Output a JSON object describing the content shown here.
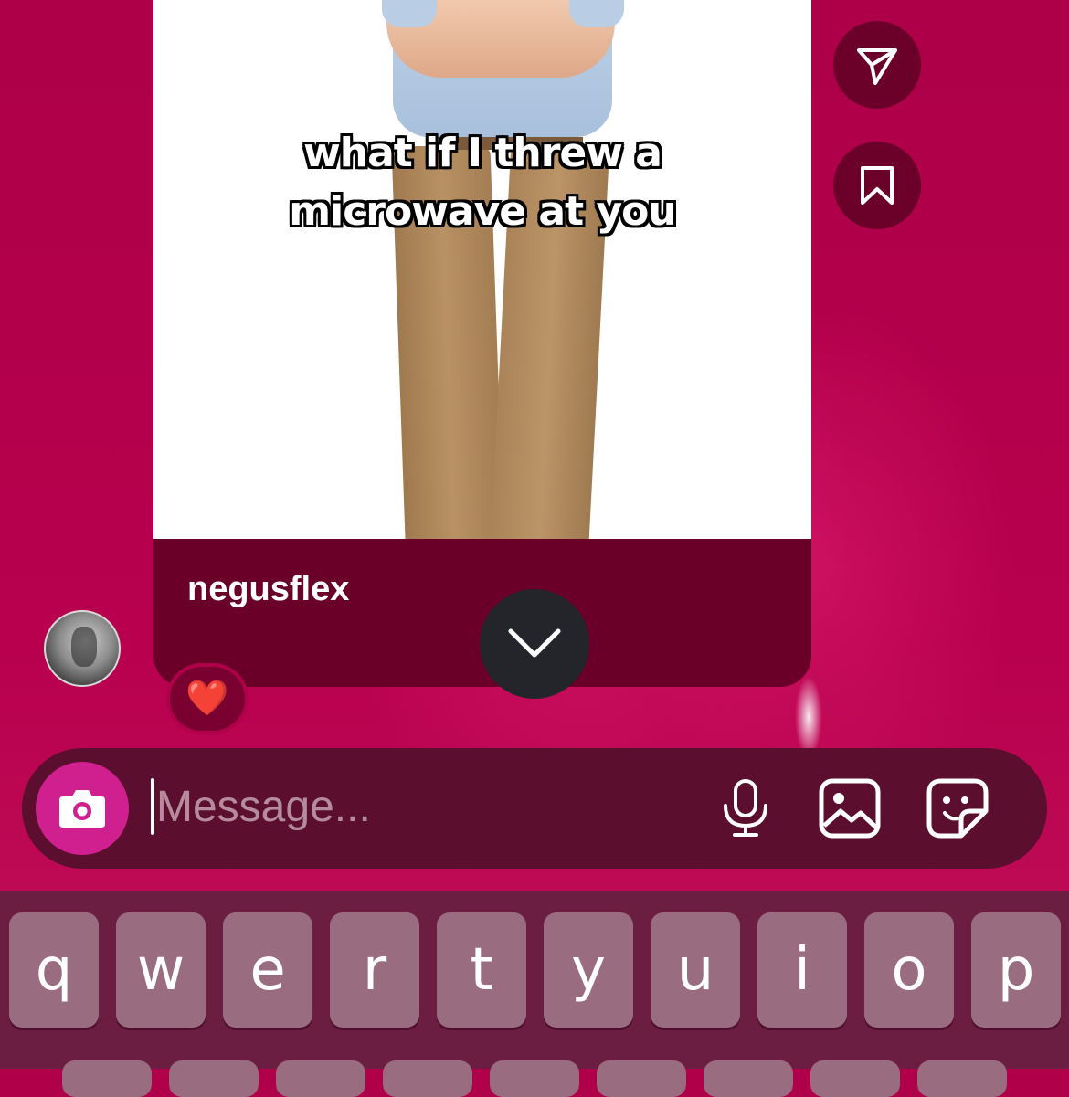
{
  "post": {
    "caption_line1": "what if I threw a",
    "caption_line2": "microwave at you",
    "username": "negusflex"
  },
  "reaction": {
    "emoji": "❤️"
  },
  "actions": {
    "share_icon": "send-icon",
    "save_icon": "bookmark-icon",
    "scroll_icon": "chevron-down-icon"
  },
  "composer": {
    "placeholder": "Message...",
    "value": "",
    "icons": [
      "camera-icon",
      "microphone-icon",
      "gallery-icon",
      "sticker-icon"
    ]
  },
  "keyboard": {
    "row1": [
      "q",
      "w",
      "e",
      "r",
      "t",
      "y",
      "u",
      "i",
      "o",
      "p"
    ]
  },
  "colors": {
    "background": "#b0004a",
    "card": "#6a0028",
    "camera_button": "#d01f8f",
    "keyboard": "#6c1d42",
    "key": "#9a6c80"
  }
}
